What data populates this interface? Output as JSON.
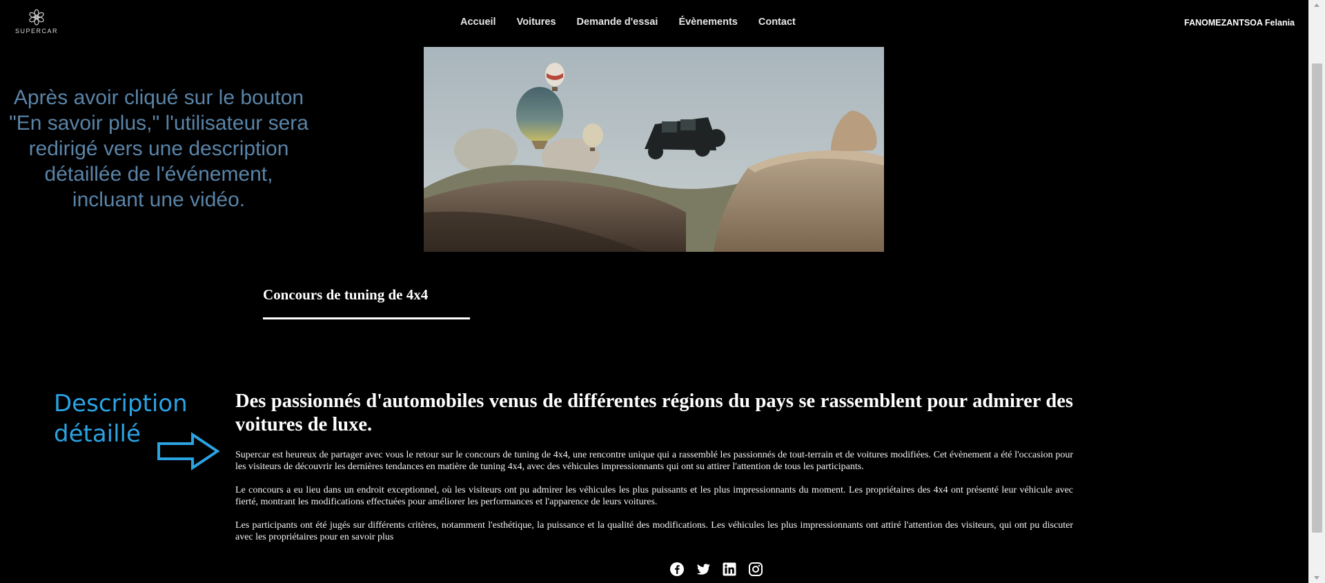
{
  "brand": {
    "logo_text": "SUPERCAR"
  },
  "nav": {
    "items": [
      {
        "label": "Accueil"
      },
      {
        "label": "Voitures"
      },
      {
        "label": "Demande d'essai"
      },
      {
        "label": "Évènements"
      },
      {
        "label": "Contact"
      }
    ]
  },
  "user": {
    "name": "FANOMEZANTSOA Felania"
  },
  "annotations": {
    "video_note": "Après avoir cliqué sur le bouton \"En savoir plus,\" l'utilisateur sera redirigé vers une description détaillée de l'événement, incluant une vidéo.",
    "description_label_line1": "Description",
    "description_label_line2": "détaillé"
  },
  "event": {
    "title": "Concours de tuning de 4x4",
    "headline": "Des passionnés d'automobiles venus de différentes régions du pays se rassemblent pour admirer des voitures de luxe.",
    "paragraphs": [
      "Supercar est heureux de partager avec vous le retour sur le concours de tuning de 4x4, une rencontre unique qui a rassemblé les passionnés de tout-terrain et de voitures modifiées. Cet évènement a été l'occasion pour les visiteurs de découvrir les dernières tendances en matière de tuning 4x4, avec des véhicules impressionnants qui ont su attirer l'attention de tous les participants.",
      "Le concours a eu lieu dans un endroit exceptionnel, où les visiteurs ont pu admirer les véhicules les plus puissants et les plus impressionnants du moment. Les propriétaires des 4x4 ont présenté leur véhicule avec fierté, montrant les modifications effectuées pour améliorer les performances et l'apparence de leurs voitures.",
      "Les participants ont été jugés sur différents critères, notamment l'esthétique, la puissance et la qualité des modifications. Les véhicules les plus impressionnants ont attiré l'attention des visiteurs, qui ont pu discuter avec les propriétaires pour en savoir plus"
    ]
  },
  "socials": [
    {
      "icon": "facebook-icon"
    },
    {
      "icon": "twitter-icon"
    },
    {
      "icon": "linkedin-icon"
    },
    {
      "icon": "instagram-icon"
    }
  ],
  "colors": {
    "background": "#000000",
    "annotation_gray_blue": "#5a84a8",
    "annotation_blue": "#2ba3e3"
  }
}
